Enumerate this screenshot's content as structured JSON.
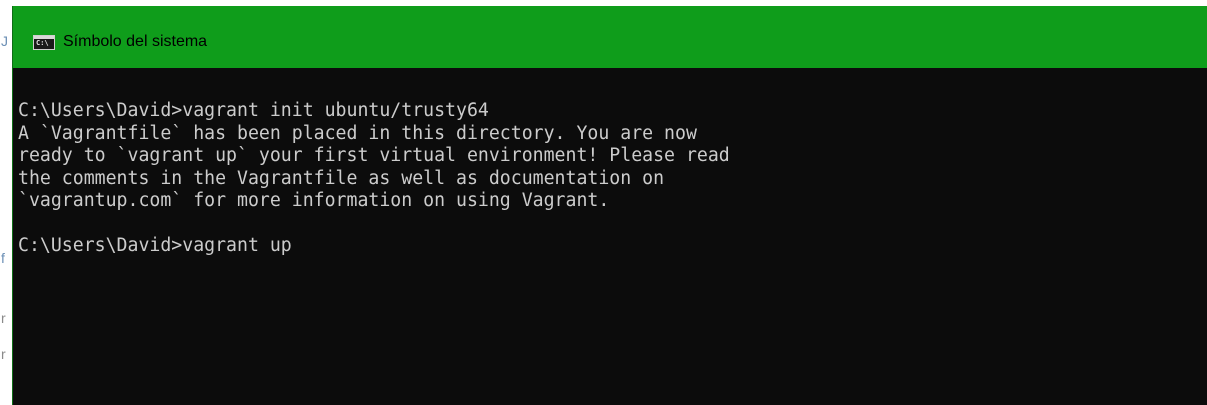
{
  "window": {
    "title": "Símbolo del sistema",
    "icon": "command-prompt-icon",
    "icon_glyph": "C:\\",
    "title_bar_color": "#0f9d1b",
    "background_color": "#0c0c0c",
    "text_color": "#cccccc"
  },
  "background_strip": {
    "chars": [
      "J",
      "f",
      "r",
      "r"
    ]
  },
  "console": {
    "lines": [
      "C:\\Users\\David>vagrant init ubuntu/trusty64",
      "A `Vagrantfile` has been placed in this directory. You are now",
      "ready to `vagrant up` your first virtual environment! Please read",
      "the comments in the Vagrantfile as well as documentation on",
      "`vagrantup.com` for more information on using Vagrant.",
      "",
      "C:\\Users\\David>vagrant up"
    ]
  }
}
